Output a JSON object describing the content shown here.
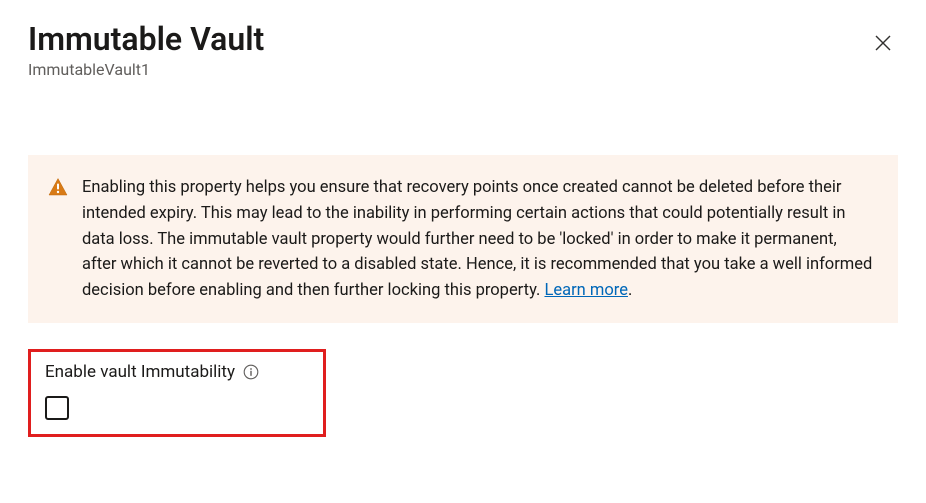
{
  "header": {
    "title": "Immutable Vault",
    "subtitle": "ImmutableVault1"
  },
  "warning": {
    "text": "Enabling this property helps you ensure that recovery points once created cannot be deleted before their intended expiry. This may lead to the inability in performing certain actions that could potentially result in data loss. The immutable vault property would further need to be 'locked' in order to make it permanent, after which it cannot be reverted to a disabled state. Hence, it is recommended that you take a well informed decision before enabling and then further locking this property. ",
    "learn_more_label": "Learn more"
  },
  "form": {
    "enable_label": "Enable vault Immutability",
    "checked": false
  }
}
